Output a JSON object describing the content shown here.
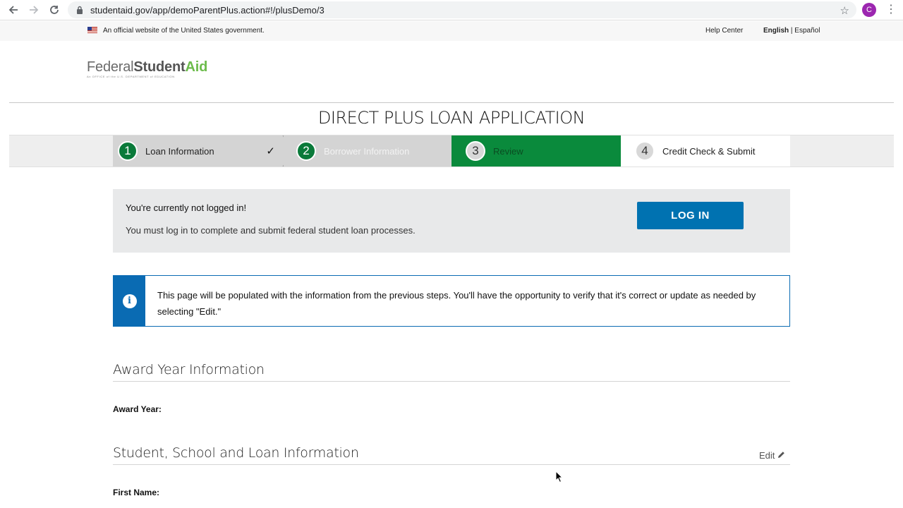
{
  "browser": {
    "url": "studentaid.gov/app/demoParentPlus.action#!/plusDemo/3",
    "profile_initial": "C"
  },
  "gov_banner": {
    "official_text": "An official website of the United States government.",
    "help": "Help Center",
    "lang_english": "English",
    "lang_sep": "|",
    "lang_spanish": "Español"
  },
  "logo": {
    "federal": "Federal",
    "student": "Student",
    "aid": "Aid",
    "subtitle": "An OFFICE of the U.S. DEPARTMENT of EDUCATION"
  },
  "page_title": "DIRECT PLUS LOAN APPLICATION",
  "steps": [
    {
      "number": "1",
      "label": "Loan Information",
      "check": "✓"
    },
    {
      "number": "2",
      "label": "Borrower Information"
    },
    {
      "number": "3",
      "label": "Review"
    },
    {
      "number": "4",
      "label": "Credit Check & Submit"
    }
  ],
  "login_panel": {
    "title": "You're currently not logged in!",
    "text": "You must log in to complete and submit federal student loan processes.",
    "button": "LOG IN"
  },
  "info": {
    "icon": "i",
    "text": "This page will be populated with the information from the previous steps. You'll have the opportunity to verify that it's correct or update as needed by selecting \"Edit.\""
  },
  "sections": {
    "award": {
      "title": "Award Year Information",
      "field": "Award Year:"
    },
    "student": {
      "title": "Student, School and Loan Information",
      "edit": "Edit",
      "field": "First Name:"
    }
  },
  "colors": {
    "step_green": "#0a8a3c",
    "primary_blue": "#0072b1",
    "info_blue": "#0a6bb3"
  }
}
